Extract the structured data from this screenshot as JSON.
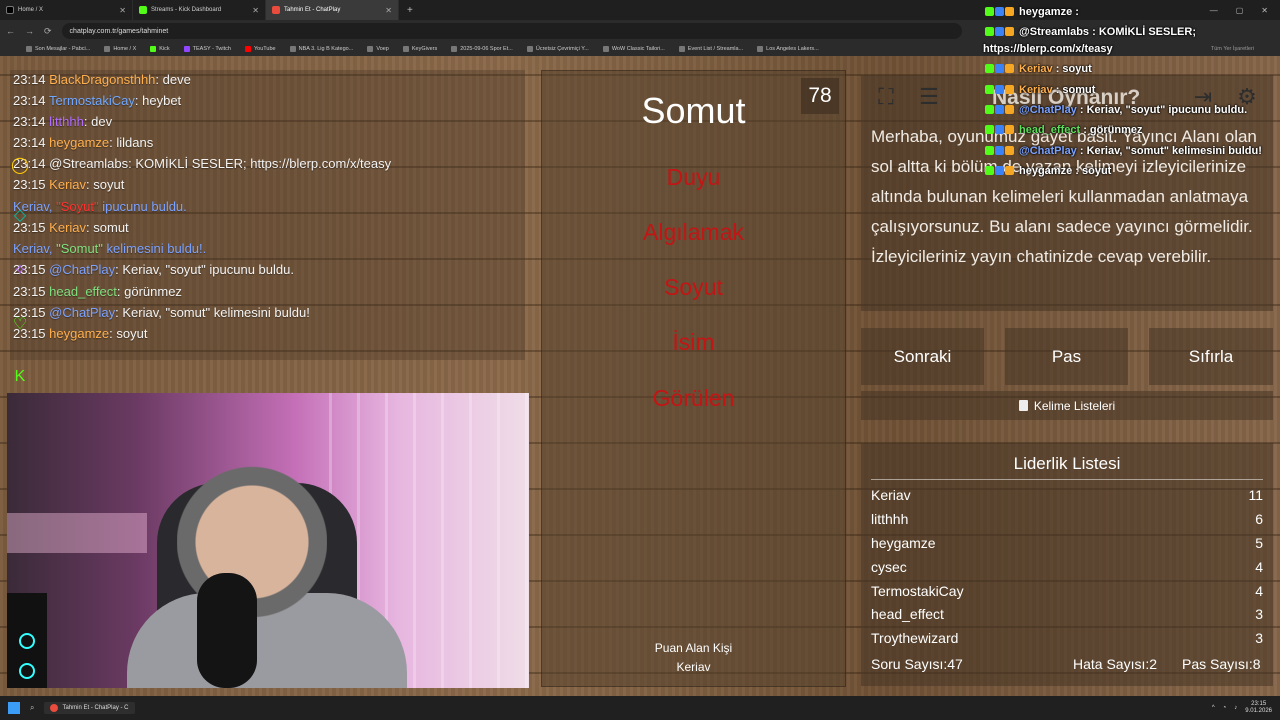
{
  "browser": {
    "tabs": [
      {
        "title": "Home / X",
        "color": "#000000"
      },
      {
        "title": "Streams - Kick Dashboard",
        "color": "#53fc18"
      },
      {
        "title": "Tahmin Et - ChatPlay",
        "color": "#e94b3c"
      }
    ],
    "url": "chatplay.com.tr/games/tahminet",
    "bookmarks": [
      "Son Mesajlar - Pabci...",
      "Home / X",
      "Kick",
      "TEASY - Twitch",
      "YouTube",
      "NBA 3. Lig B Katego...",
      "Voep",
      "KeyGivers",
      "2025-09-06 Spor Et...",
      "Ücretsiz Çevrimiçi Y...",
      "WoW Classic Tailori...",
      "Event List / Streamla...",
      "Los Angeles Lakers..."
    ],
    "all_bookmarks": "Tüm Yer İşaretleri"
  },
  "chat": [
    {
      "time": "23:14",
      "user": "BlackDragonsthhh",
      "uclass": "u-orange",
      "sep": ": ",
      "msg": "deve"
    },
    {
      "time": "23:14",
      "user": "TermostakiCay",
      "uclass": "u-blue",
      "sep": ": ",
      "msg": "heybet"
    },
    {
      "time": "23:14",
      "user": "litthhh",
      "uclass": "u-purple",
      "sep": ": ",
      "msg": "dev"
    },
    {
      "time": "23:14",
      "user": "heygamze",
      "uclass": "u-orange",
      "sep": ": ",
      "msg": "lildans"
    },
    {
      "time": "23:14",
      "user": "@Streamlabs",
      "uclass": "",
      "sep": ": ",
      "msg": "KOMİKLİ SESLER; https://blerp.com/x/teasy"
    },
    {
      "time": "23:15",
      "user": "Keriav",
      "uclass": "u-orange",
      "sep": ": ",
      "msg": "soyut"
    },
    {
      "time": "",
      "user": "Keriav, ",
      "uclass": "u-dim",
      "sep": "\"Soyut\"",
      "msg": " ipucunu buldu."
    },
    {
      "time": "23:15",
      "user": "Keriav",
      "uclass": "u-orange",
      "sep": ": ",
      "msg": "somut"
    },
    {
      "time": "",
      "user": "Keriav, ",
      "uclass": "u-dim",
      "sep": "\"Somut\"",
      "msg": " kelimesini buldu!."
    },
    {
      "time": "23:15",
      "user": "@ChatPlay",
      "uclass": "u-dim",
      "sep": ": ",
      "msg": "Keriav, \"soyut\" ipucunu buldu."
    },
    {
      "time": "23:15",
      "user": "head_effect",
      "uclass": "u-green",
      "sep": ": ",
      "msg": "görünmez"
    },
    {
      "time": "23:15",
      "user": "@ChatPlay",
      "uclass": "u-dim",
      "sep": ": ",
      "msg": "Keriav, \"somut\" kelimesini buldu!"
    },
    {
      "time": "23:15",
      "user": "heygamze",
      "uclass": "u-orange",
      "sep": ": ",
      "msg": "soyut"
    }
  ],
  "card": {
    "word": "Somut",
    "count": "78",
    "forbidden": [
      "Duyu",
      "Algılamak",
      "Soyut",
      "İsim",
      "Görülen"
    ],
    "scorer_label": "Puan Alan Kişi",
    "scorer_name": "Keriav"
  },
  "howto": {
    "title": "Nasıl Oynanır?",
    "text": "Merhaba, oyunumuz gayet basit. Yayıncı Alanı olan sol altta ki bölüm de yazan kelimeyi izleyicilerinize altında bulunan kelimeleri kullanmadan anlatmaya çalışıyorsunuz. Bu alanı sadece yayıncı görmelidir. İzleyicileriniz yayın chatinizde cevap verebilir."
  },
  "buttons": {
    "next": "Sonraki",
    "pass": "Pas",
    "reset": "Sıfırla",
    "wordlists": "Kelime Listeleri"
  },
  "leaderboard": {
    "title": "Liderlik Listesi",
    "rows": [
      {
        "name": "Keriav",
        "score": "11"
      },
      {
        "name": "litthhh",
        "score": "6"
      },
      {
        "name": "heygamze",
        "score": "5"
      },
      {
        "name": "cysec",
        "score": "4"
      },
      {
        "name": "TermostakiCay",
        "score": "4"
      },
      {
        "name": "head_effect",
        "score": "3"
      },
      {
        "name": "Troythewizard",
        "score": "3"
      }
    ],
    "questions": "Soru Sayısı:47",
    "errors": "Hata Sayısı:2",
    "passes": "Pas Sayısı:8"
  },
  "overlay": [
    {
      "user": "heygamze",
      "sep": " : ",
      "msg": "",
      "uclass": ""
    },
    {
      "user": "@Streamlabs",
      "sep": " : ",
      "msg": "KOMİKLİ SESLER;",
      "uclass": ""
    },
    {
      "user": "",
      "sep": "",
      "msg": "https://blerp.com/x/teasy",
      "uclass": ""
    },
    {
      "user": "Keriav",
      "sep": " : ",
      "msg": "soyut",
      "uclass": "u-orange"
    },
    {
      "user": "Keriav",
      "sep": " : ",
      "msg": "somut",
      "uclass": "u-orange"
    },
    {
      "user": "@ChatPlay",
      "sep": " : ",
      "msg": "Keriav, \"soyut\" ipucunu buldu.",
      "uclass": "u-dim"
    },
    {
      "user": "head_effect",
      "sep": " : ",
      "msg": "görünmez",
      "uclass": "u-green"
    },
    {
      "user": "@ChatPlay",
      "sep": " : ",
      "msg": "Keriav, \"somut\" kelimesini buldu!",
      "uclass": "u-dim"
    },
    {
      "user": "heygamze",
      "sep": " : ",
      "msg": "soyut",
      "uclass": ""
    }
  ],
  "taskbar": {
    "app": "Tahmin Et - ChatPlay - C",
    "time": "23:15",
    "date": "9.01.2026"
  },
  "colors": {
    "forbidden": "#c41414",
    "kick": "#53fc18"
  }
}
